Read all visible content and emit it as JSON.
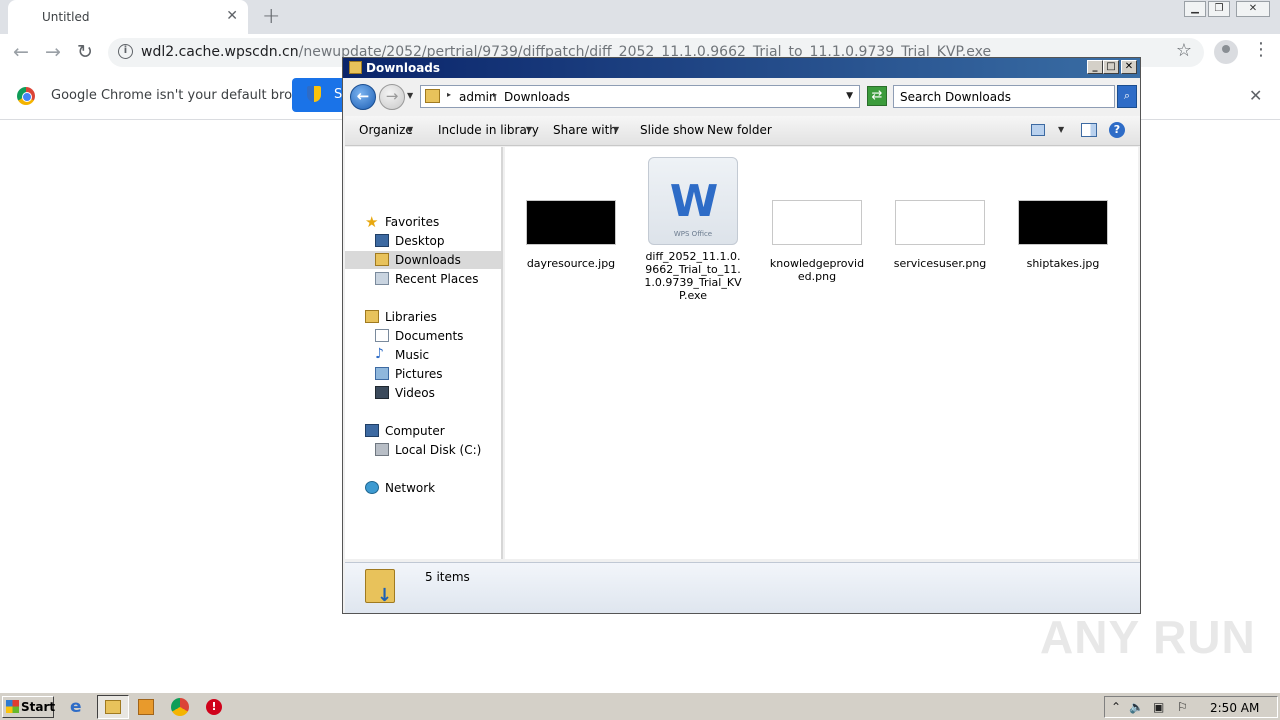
{
  "chrome": {
    "tab_title": "Untitled",
    "url_host": "wdl2.cache.wpscdn.cn",
    "url_path": "/newupdate/2052/pertrial/9739/diffpatch/diff_2052_11.1.0.9662_Trial_to_11.1.0.9739_Trial_KVP.exe",
    "infobar_text": "Google Chrome isn't your default browser",
    "infobar_button_label": "S"
  },
  "explorer": {
    "title": "Downloads",
    "breadcrumb": [
      "admin",
      "Downloads"
    ],
    "search_placeholder": "Search Downloads",
    "toolbar": {
      "organize": "Organize",
      "include": "Include in library",
      "share": "Share with",
      "slideshow": "Slide show",
      "newfolder": "New folder"
    },
    "nav": {
      "favorites": "Favorites",
      "desktop": "Desktop",
      "downloads": "Downloads",
      "recent": "Recent Places",
      "libraries": "Libraries",
      "documents": "Documents",
      "music": "Music",
      "pictures": "Pictures",
      "videos": "Videos",
      "computer": "Computer",
      "localdisk": "Local Disk (C:)",
      "network": "Network"
    },
    "files": [
      {
        "name": "dayresource.jpg",
        "thumb": "black"
      },
      {
        "name": "diff_2052_11.1.0.9662_Trial_to_11.1.0.9739_Trial_KVP.exe",
        "thumb": "wps"
      },
      {
        "name": "knowledgeprovided.png",
        "thumb": "white"
      },
      {
        "name": "servicesuser.png",
        "thumb": "white"
      },
      {
        "name": "shiptakes.jpg",
        "thumb": "black"
      }
    ],
    "wps_caption": "WPS Office",
    "status": "5 items"
  },
  "taskbar": {
    "start": "Start",
    "clock": "2:50 AM"
  },
  "watermark": "ANY RUN"
}
